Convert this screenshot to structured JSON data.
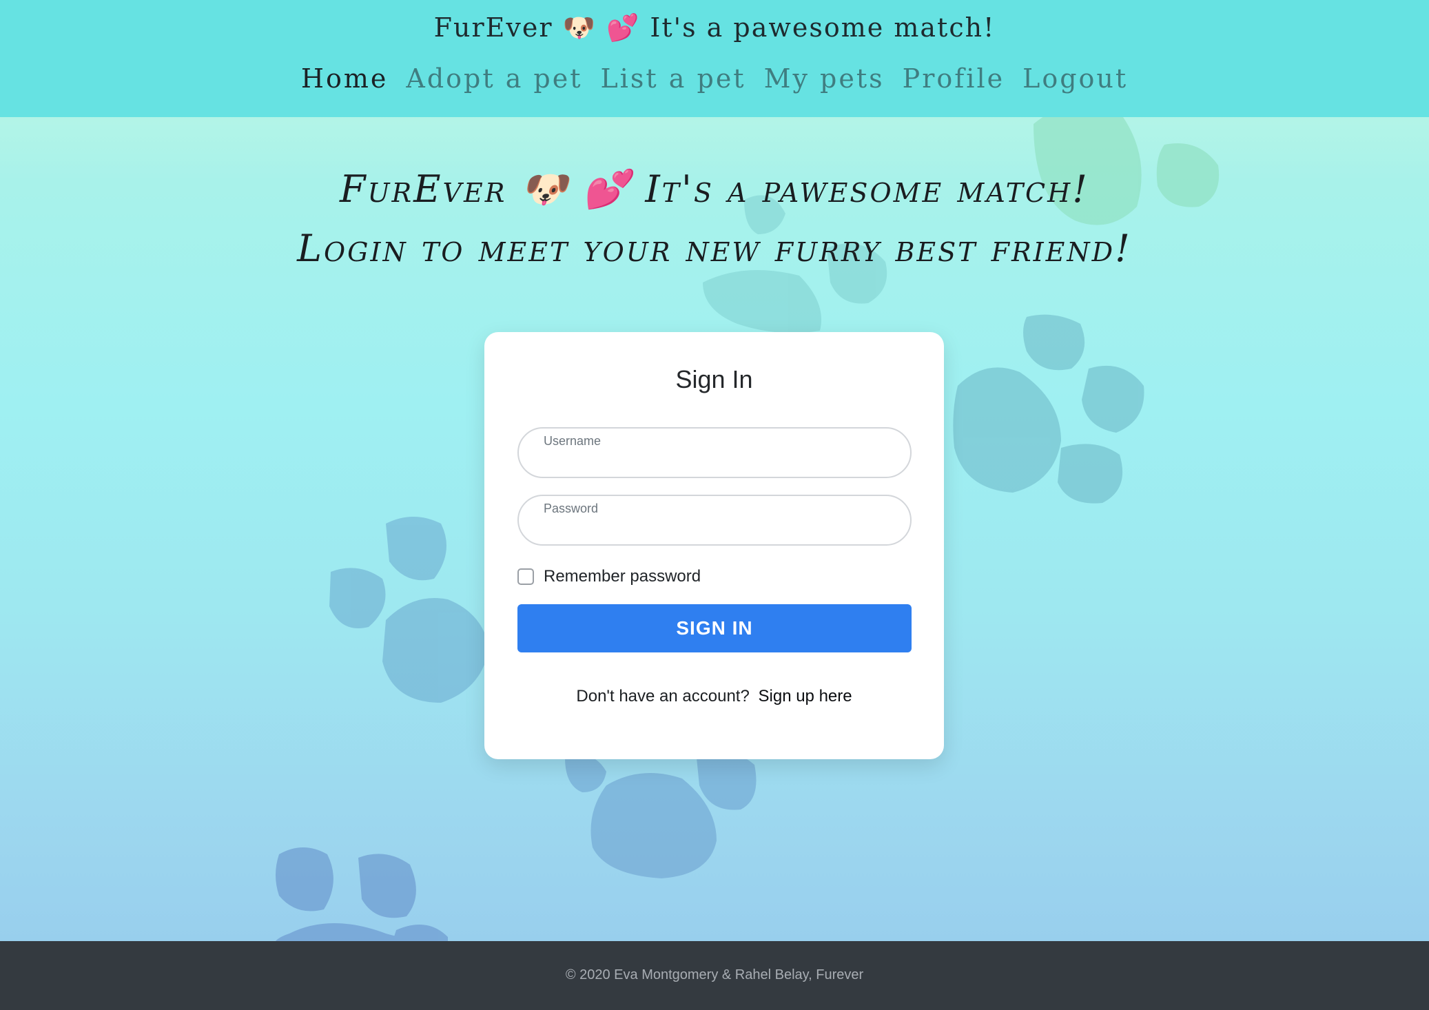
{
  "header": {
    "brand": "FurEver 🐶 💕 It's a pawesome match!",
    "nav": [
      {
        "label": "Home",
        "active": true
      },
      {
        "label": "Adopt a pet",
        "active": false
      },
      {
        "label": "List a pet",
        "active": false
      },
      {
        "label": "My pets",
        "active": false
      },
      {
        "label": "Profile",
        "active": false
      },
      {
        "label": "Logout",
        "active": false
      }
    ]
  },
  "hero": {
    "line1": "FurEver 🐶 💕 It's a pawesome match!",
    "line2": "Login to meet your new furry best friend!"
  },
  "login": {
    "title": "Sign In",
    "username_label": "Username",
    "username_value": "",
    "password_label": "Password",
    "password_value": "",
    "remember_label": "Remember password",
    "remember_checked": false,
    "submit_label": "SIGN IN",
    "signup_prompt": "Don't have an account?",
    "signup_link": "Sign up here"
  },
  "footer": {
    "copyright": "© 2020 Eva Montgomery & Rahel Belay, Furever"
  },
  "colors": {
    "header_bg": "#66e2e2",
    "primary_button": "#2f7ff0",
    "footer_bg": "#343a40"
  }
}
